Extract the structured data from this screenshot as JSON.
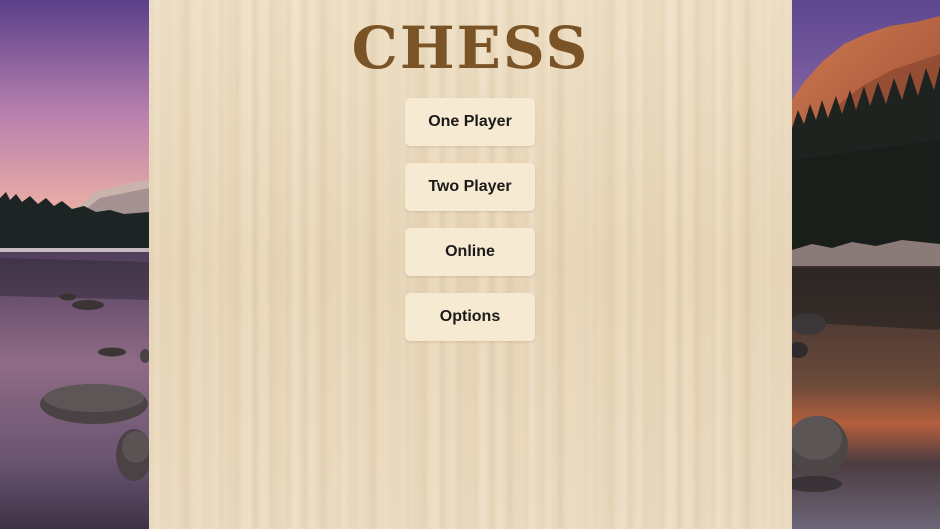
{
  "app": {
    "title": "CHESS"
  },
  "menu": {
    "items": [
      {
        "id": "one-player",
        "label": "One Player"
      },
      {
        "id": "two-player",
        "label": "Two Player"
      },
      {
        "id": "online",
        "label": "Online"
      },
      {
        "id": "options",
        "label": "Options"
      }
    ]
  },
  "colors": {
    "title": "#7a5426",
    "panel_wood": "#ecdcc0",
    "button_bg": "#f6ead3",
    "button_text": "#1c1a18"
  }
}
